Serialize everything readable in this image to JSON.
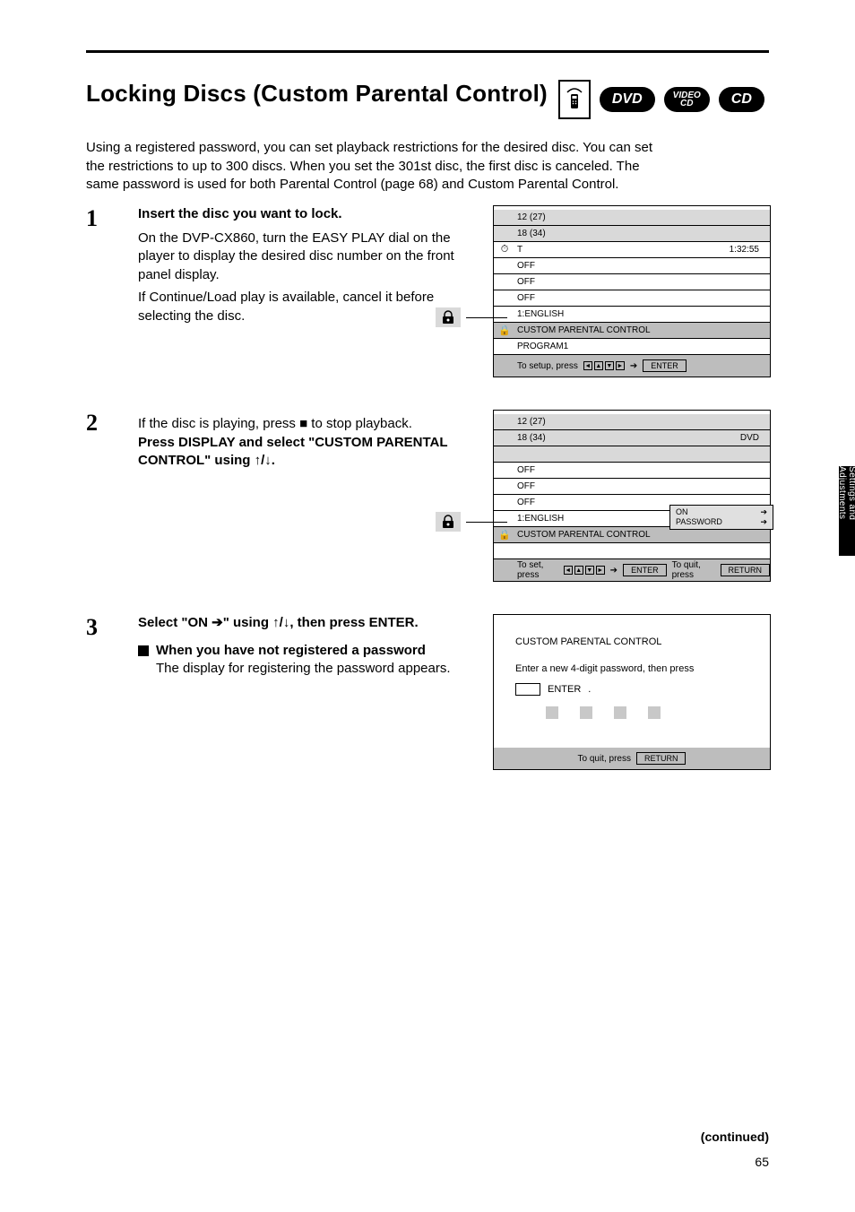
{
  "header": {
    "title": "Locking Discs (Custom Parental Control)",
    "badges": {
      "dvd": "DVD",
      "vcd_line1": "VIDEO",
      "vcd_line2": "CD",
      "cd": "CD"
    }
  },
  "intro": "Using a registered password, you can set playback restrictions for the desired disc. You can set the restrictions to up to 300 discs. When you set the 301st disc, the first disc is canceled.\nThe same password is used for both Parental Control (page 68) and Custom Parental Control.",
  "steps": [
    {
      "num": "1",
      "title": "Insert the disc you want to lock.",
      "body": "On the DVP-CX860, turn the EASY PLAY dial on the player to display the desired disc number on the front panel display.",
      "when": "",
      "note": "If Continue/Load play is available, cancel it before selecting the disc."
    },
    {
      "num": "2",
      "title": "Press DISPLAY and select \"CUSTOM PARENTAL CONTROL\" using ↑/↓.",
      "body": "If the disc is playing, press ■ to stop playback.",
      "when": ""
    },
    {
      "num": "3",
      "title": "Select \"ON ➔\" using ↑/↓, then press ENTER.",
      "body": "",
      "when": "When you have not registered a password",
      "note": "The display for registering the password appears."
    }
  ],
  "menu1": {
    "corner": "▶",
    "rows": [
      {
        "lbl": "12 (27)",
        "val": ""
      },
      {
        "lbl": "18 (34)",
        "val": ""
      },
      {
        "lbl": "T",
        "val": "1:32:55"
      },
      {
        "lbl": "OFF",
        "val": ""
      },
      {
        "lbl": "OFF",
        "val": ""
      },
      {
        "lbl": "OFF",
        "val": ""
      },
      {
        "lbl": "1:ENGLISH",
        "val": ""
      },
      {
        "lbl": "CUSTOM PARENTAL CONTROL",
        "val": "",
        "shaded": true
      },
      {
        "lbl": "PROGRAM1",
        "val": ""
      }
    ],
    "nav": {
      "hint": "To setup, press",
      "enter": "ENTER"
    }
  },
  "menu2": {
    "corner": "■",
    "rows": [
      {
        "lbl": "12 (27)",
        "val": ""
      },
      {
        "lbl": "18 (34)",
        "val": "DVD"
      },
      {
        "lbl": "",
        "val": ""
      },
      {
        "lbl": "OFF",
        "val": ""
      },
      {
        "lbl": "OFF",
        "val": ""
      },
      {
        "lbl": "OFF",
        "val": ""
      },
      {
        "lbl": "1:ENGLISH",
        "val": ""
      },
      {
        "lbl": "CUSTOM PARENTAL CONTROL",
        "val": "",
        "shaded": true
      },
      {
        "lbl": "",
        "val": ""
      }
    ],
    "nested": {
      "on": "ON",
      "password": "PASSWORD",
      "arrow": "➔"
    },
    "nav": {
      "hint": "To set, press",
      "enter": "ENTER",
      "return": "RETURN",
      "to_quit": "To quit, press"
    }
  },
  "pw_shot": {
    "title": "CUSTOM PARENTAL CONTROL",
    "line1": "Enter a new 4-digit password, then press",
    "enter": "ENTER",
    "footer_to_quit": "To quit, press",
    "footer_return": "RETURN"
  },
  "side_tab": "Settings and Adjustments",
  "continue": "(continued)",
  "pagenum": "65"
}
